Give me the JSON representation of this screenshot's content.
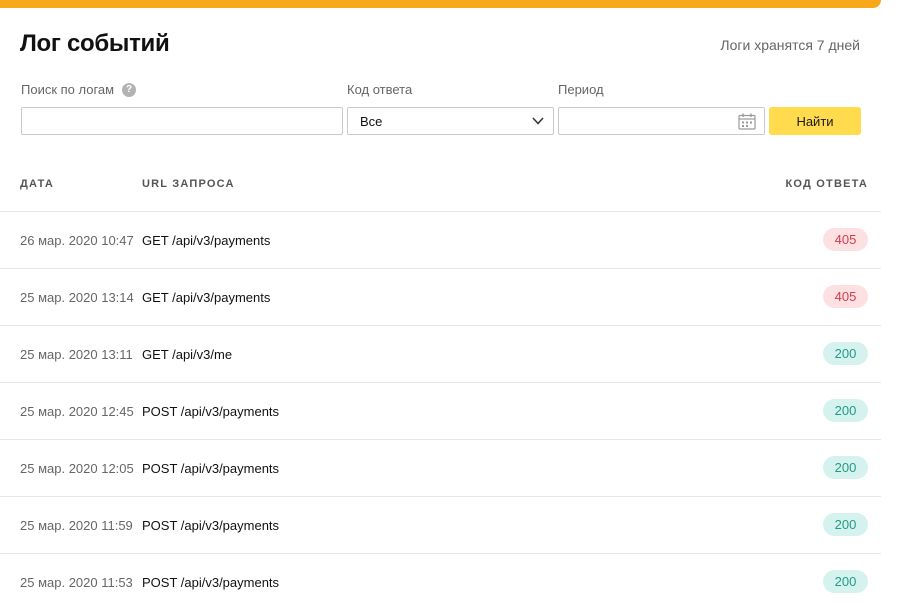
{
  "header": {
    "title": "Лог событий",
    "retention_note": "Логи хранятся 7 дней"
  },
  "filters": {
    "search": {
      "label": "Поиск по логам",
      "value": "",
      "placeholder": ""
    },
    "status_code": {
      "label": "Код ответа",
      "selected": "Все"
    },
    "period": {
      "label": "Период",
      "value": ""
    },
    "find_label": "Найти"
  },
  "table": {
    "columns": [
      "Дата",
      "URL запроса",
      "Код ответа"
    ],
    "rows": [
      {
        "date": "26 мар. 2020 10:47",
        "url": "GET /api/v3/payments",
        "code": "405"
      },
      {
        "date": "25 мар. 2020 13:14",
        "url": "GET /api/v3/payments",
        "code": "405"
      },
      {
        "date": "25 мар. 2020 13:11",
        "url": "GET /api/v3/me",
        "code": "200"
      },
      {
        "date": "25 мар. 2020 12:45",
        "url": "POST /api/v3/payments",
        "code": "200"
      },
      {
        "date": "25 мар. 2020 12:05",
        "url": "POST /api/v3/payments",
        "code": "200"
      },
      {
        "date": "25 мар. 2020 11:59",
        "url": "POST /api/v3/payments",
        "code": "200"
      },
      {
        "date": "25 мар. 2020 11:53",
        "url": "POST /api/v3/payments",
        "code": "200"
      }
    ]
  },
  "colors": {
    "accent_bar": "#f7a81b",
    "button": "#ffdb4d",
    "error_badge_bg": "#fde0e2",
    "error_badge_text": "#d43c4a",
    "ok_badge_bg": "#d6f2ee",
    "ok_badge_text": "#1f9c87"
  },
  "icons": {
    "help": "question-circle-icon",
    "dropdown": "chevron-down-icon",
    "period": "calendar-icon"
  }
}
